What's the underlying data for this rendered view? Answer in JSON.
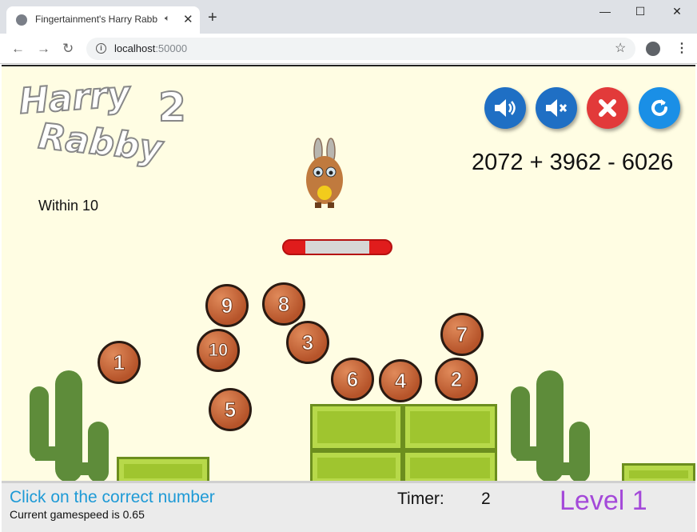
{
  "browser": {
    "tab_title": "Fingertainment's Harry Rabb",
    "tab_audio_icon": "speaker-icon",
    "new_tab": "+",
    "url_host": "localhost",
    "url_port": ":50000",
    "nav_back": "←",
    "nav_forward": "→",
    "nav_reload": "↻",
    "win_min": "—",
    "win_max": "☐",
    "win_close": "✕",
    "star": "☆",
    "menu": "⋮",
    "info": "i",
    "tab_close": "✕"
  },
  "game": {
    "logo_line1": "Harry",
    "logo_line2": "Rabby",
    "logo_number": "2",
    "equation": "2072 + 3962 - 6026",
    "range_label": "Within 10",
    "controls": [
      {
        "name": "sound-on-button",
        "color": "#1f6fc4",
        "icon": "speaker-icon"
      },
      {
        "name": "mute-button",
        "color": "#1f6fc4",
        "icon": "speaker-mute-icon"
      },
      {
        "name": "quit-button",
        "color": "#e23a3a",
        "icon": "close-icon"
      },
      {
        "name": "restart-button",
        "color": "#1a8fe6",
        "icon": "restart-icon"
      }
    ],
    "balls": [
      "9",
      "8",
      "10",
      "3",
      "1",
      "7",
      "6",
      "4",
      "2",
      "5"
    ],
    "accent_color": "#a449d9",
    "message_color": "#1e9ad6"
  },
  "status": {
    "message": "Click on the correct number",
    "speed_text": "Current gamespeed is 0.65",
    "timer_label": "Timer:",
    "timer_value": "2",
    "level": "Level 1"
  }
}
